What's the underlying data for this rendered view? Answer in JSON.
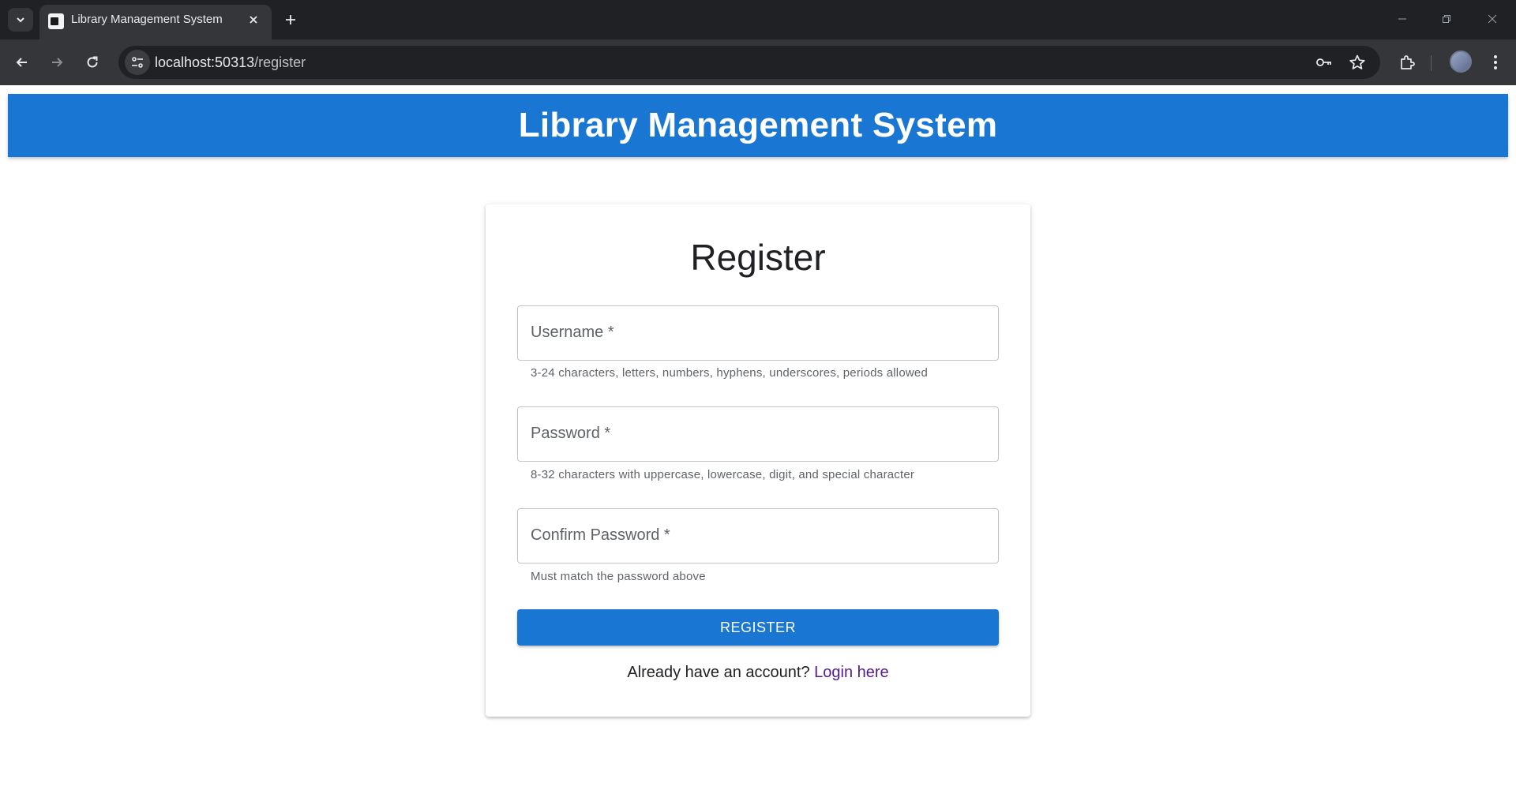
{
  "browser": {
    "tab_title": "Library Management System",
    "url_host": "localhost:50313",
    "url_path": "/register"
  },
  "header": {
    "title": "Library Management System",
    "bg_color": "#1976d2"
  },
  "form": {
    "title": "Register",
    "username": {
      "label": "Username *",
      "value": "",
      "helper": "3-24 characters, letters, numbers, hyphens, underscores, periods allowed"
    },
    "password": {
      "label": "Password *",
      "value": "",
      "helper": "8-32 characters with uppercase, lowercase, digit, and special character"
    },
    "confirm_password": {
      "label": "Confirm Password *",
      "value": "",
      "helper": "Must match the password above"
    },
    "submit_label": "REGISTER",
    "login_prompt": "Already have an account?",
    "login_link": "Login here"
  },
  "icons": {
    "tab_list": "chevron-down-icon",
    "tab_close": "close-icon",
    "new_tab": "plus-icon",
    "back": "arrow-left-icon",
    "forward": "arrow-right-icon",
    "reload": "reload-icon",
    "site_info": "tune-icon",
    "password_manager": "key-icon",
    "bookmark": "star-icon",
    "extensions": "puzzle-icon",
    "menu": "kebab-menu-icon"
  }
}
